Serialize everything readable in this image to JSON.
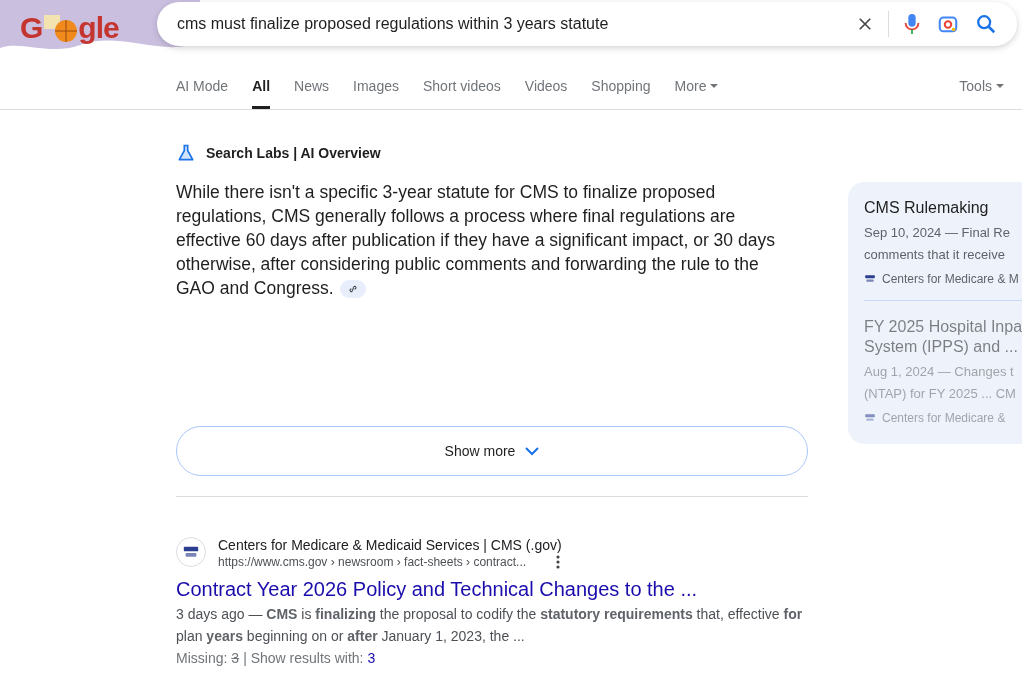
{
  "logo": {
    "left": "G",
    "right": "gle"
  },
  "search": {
    "value": "cms must finalize proposed regulations within 3 years statute"
  },
  "tabs": [
    {
      "label": "AI Mode",
      "selected": false
    },
    {
      "label": "All",
      "selected": true
    },
    {
      "label": "News",
      "selected": false
    },
    {
      "label": "Images",
      "selected": false
    },
    {
      "label": "Short videos",
      "selected": false
    },
    {
      "label": "Videos",
      "selected": false
    },
    {
      "label": "Shopping",
      "selected": false
    },
    {
      "label": "More",
      "selected": false,
      "dropdown": true
    }
  ],
  "tools": {
    "label": "Tools"
  },
  "ai_overview": {
    "title": "Search Labs | AI Overview",
    "text": "While there isn't a specific 3-year statute for CMS to finalize proposed regulations, CMS generally follows a process where final regulations are effective 60 days after publication if they have a significant impact, or 30 days otherwise, after considering public comments and forwarding the rule to the GAO and Congress.",
    "show_more": "Show more"
  },
  "sources": [
    {
      "title": "CMS Rulemaking",
      "lines": [
        "Sep 10, 2024 — Final Re",
        "comments that it receive"
      ],
      "site": "Centers for Medicare & M",
      "faded": false
    },
    {
      "title": "FY 2025 Hospital Inpa",
      "title_2": "System (IPPS) and ...",
      "lines": [
        "Aug 1, 2024 — Changes t",
        "(NTAP) for FY 2025 ... CM"
      ],
      "site": "Centers for Medicare &",
      "faded": true
    }
  ],
  "result": {
    "site_name": "Centers for Medicare & Medicaid Services | CMS (.gov)",
    "url": "https://www.cms.gov › newsroom › fact-sheets › contract...",
    "title": "Contract Year 2026 Policy and Technical Changes to the ...",
    "snippet": "3 days ago — **CMS** is **finalizing** the proposal to codify the **statutory requirements** that, effective **for** plan **years** beginning on or **after** January 1, 2023, the ...",
    "missing_label": "Missing:",
    "missing_term": "3",
    "show_with_label": "| Show results with:",
    "show_with_term": "3"
  }
}
